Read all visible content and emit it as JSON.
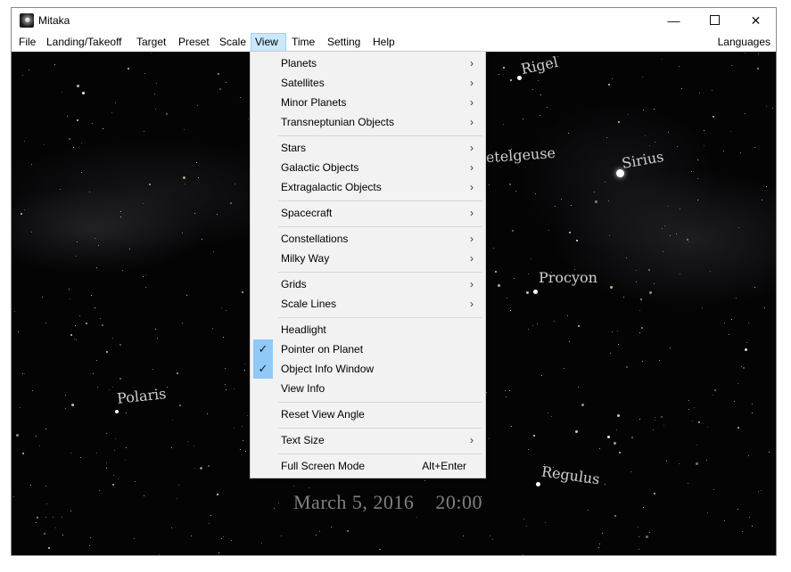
{
  "window": {
    "title": "Mitaka",
    "controls": {
      "minimize": "—",
      "maximize": "",
      "close": "✕"
    }
  },
  "menubar": {
    "items": [
      "File",
      "Landing/Takeoff",
      "Target",
      "Preset",
      "Scale",
      "View",
      "Time",
      "Setting",
      "Help"
    ],
    "active": "View",
    "right": "Languages"
  },
  "view_menu": {
    "items": [
      {
        "label": "Planets",
        "submenu": true
      },
      {
        "label": "Satellites",
        "submenu": true
      },
      {
        "label": "Minor Planets",
        "submenu": true
      },
      {
        "label": "Transneptunian Objects",
        "submenu": true
      },
      {
        "label": "Stars",
        "submenu": true
      },
      {
        "label": "Galactic Objects",
        "submenu": true
      },
      {
        "label": "Extragalactic Objects",
        "submenu": true
      },
      {
        "label": "Spacecraft",
        "submenu": true
      },
      {
        "label": "Constellations",
        "submenu": true
      },
      {
        "label": "Milky Way",
        "submenu": true
      },
      {
        "label": "Grids",
        "submenu": true
      },
      {
        "label": "Scale Lines",
        "submenu": true
      },
      {
        "label": "Headlight",
        "checked": false
      },
      {
        "label": "Pointer on Planet",
        "checked": true
      },
      {
        "label": "Object Info Window",
        "checked": true
      },
      {
        "label": "View Info",
        "checked": false
      },
      {
        "label": "Reset View Angle"
      },
      {
        "label": "Text Size",
        "submenu": true
      },
      {
        "label": "Full Screen Mode",
        "shortcut": "Alt+Enter"
      }
    ],
    "submenu_arrow": "›",
    "check_glyph": "✓"
  },
  "sky": {
    "star_labels": [
      "Rigel",
      "Betelgeuse",
      "Sirius",
      "Procyon",
      "Polaris",
      "Regulus"
    ],
    "date": "March  5, 2016",
    "time": "20:00"
  },
  "colors": {
    "menu_highlight": "#cce8ff",
    "check_highlight": "#90c8f6",
    "sky_background": "#040405",
    "label_color": "#d0d0d0",
    "datetime_color": "#808080"
  }
}
